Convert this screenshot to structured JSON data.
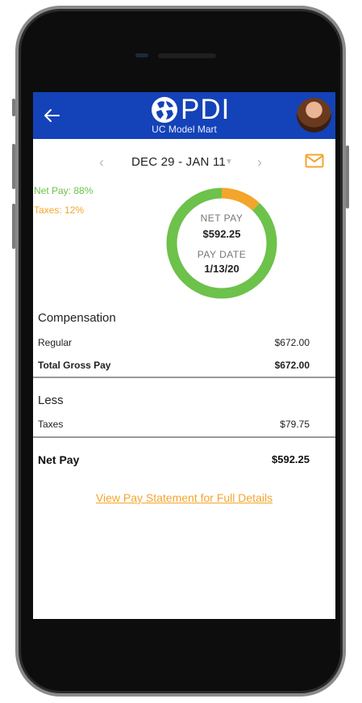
{
  "header": {
    "logo_text": "PDI",
    "company_name": "UC Model Mart"
  },
  "date_nav": {
    "range": "DEC 29 - JAN 11"
  },
  "legend": {
    "net_pay": "Net Pay: 88%",
    "taxes": "Taxes: 12%"
  },
  "donut": {
    "net_pay_label": "NET PAY",
    "net_pay_value": "$592.25",
    "pay_date_label": "PAY DATE",
    "pay_date_value": "1/13/20",
    "net_fraction": 0.88,
    "tax_fraction": 0.12,
    "net_color": "#6cc24a",
    "tax_color": "#f4a52c"
  },
  "compensation": {
    "title": "Compensation",
    "rows": [
      {
        "label": "Regular",
        "value": "$672.00"
      },
      {
        "label": "Total Gross Pay",
        "value": "$672.00"
      }
    ]
  },
  "less": {
    "title": "Less",
    "rows": [
      {
        "label": "Taxes",
        "value": "$79.75"
      }
    ]
  },
  "net": {
    "label": "Net Pay",
    "value": "$592.25"
  },
  "link": {
    "text": "View Pay Statement for Full Details"
  },
  "colors": {
    "header": "#1442b8",
    "accent_orange": "#f4a52c",
    "accent_green": "#6cc24a"
  }
}
